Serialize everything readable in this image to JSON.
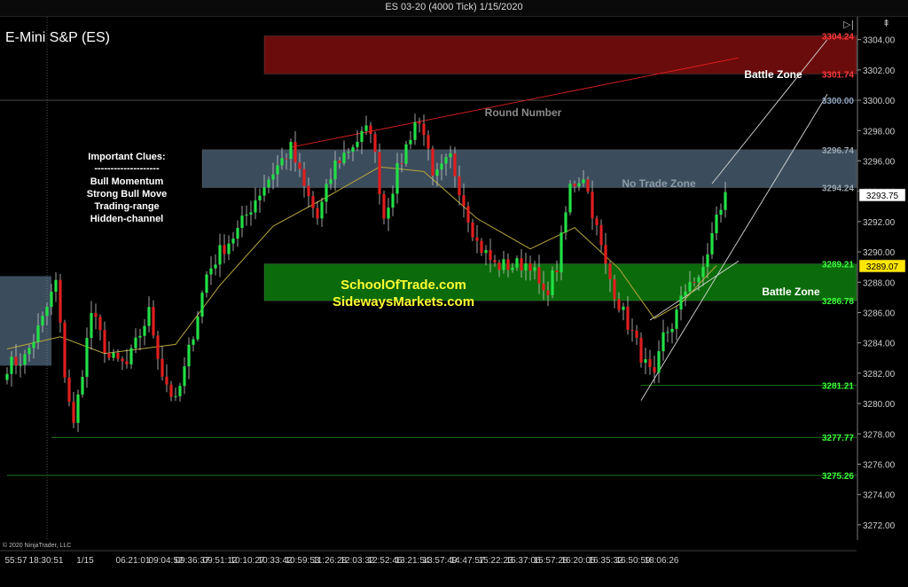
{
  "window": {
    "title": "ES 03-20 (4000 Tick)  1/15/2020",
    "instrument": "E-Mini S&P (ES)",
    "copyright": "© 2020 NinjaTrader, LLC"
  },
  "clues": {
    "heading": "Important Clues:",
    "rule": "--------------------",
    "items": [
      "Bull Momentum",
      "Strong Bull Move",
      "Trading-range",
      "Hidden-channel"
    ]
  },
  "zones": [
    {
      "name": "battle-zone-top",
      "label": "Battle Zone",
      "low": 3301.74,
      "high": 3304.24,
      "color": "#6b0c0c",
      "label_color": "#ffffff"
    },
    {
      "name": "no-trade-zone",
      "label": "No Trade Zone",
      "low": 3294.24,
      "high": 3296.74,
      "color": "#3b4d5c",
      "label_color": "#8d9ba6"
    },
    {
      "name": "battle-zone-green",
      "label": "Battle Zone",
      "low": 3286.78,
      "high": 3289.21,
      "color": "#0b6b0b",
      "label_color": "#ffffff"
    }
  ],
  "watermark": [
    "SchoolOfTrade.com",
    "SidewaysMarkets.com"
  ],
  "round_number": {
    "label": "Round Number",
    "value": 3300.0
  },
  "level_labels": [
    {
      "text": "3304.24",
      "value": 3304.24,
      "color": "#ff3b3b"
    },
    {
      "text": "3301.74",
      "value": 3301.74,
      "color": "#ff3b3b"
    },
    {
      "text": "3300.00",
      "value": 3300.0,
      "color": "#8fa3c0"
    },
    {
      "text": "3296.74",
      "value": 3296.74,
      "color": "#9aa7b3"
    },
    {
      "text": "3294.24",
      "value": 3294.24,
      "color": "#9aa7b3"
    },
    {
      "text": "3289.21",
      "value": 3289.21,
      "color": "#3cff3c"
    },
    {
      "text": "3286.78",
      "value": 3286.78,
      "color": "#3cff3c"
    },
    {
      "text": "3281.21",
      "value": 3281.21,
      "color": "#3cff3c"
    },
    {
      "text": "3277.77",
      "value": 3277.77,
      "color": "#3cff3c"
    },
    {
      "text": "3275.26",
      "value": 3275.26,
      "color": "#3cff3c"
    }
  ],
  "price_badges": [
    {
      "text": "3293.75",
      "value": 3293.75,
      "bg": "#ffffff",
      "fg": "#000000"
    },
    {
      "text": "3289.07",
      "value": 3289.07,
      "bg": "#ffe600",
      "fg": "#000000"
    }
  ],
  "chart_data": {
    "type": "candlestick",
    "y_axis": {
      "min": 3271.0,
      "max": 3305.5,
      "ticks": [
        3272,
        3274,
        3276,
        3278,
        3280,
        3282,
        3284,
        3286,
        3288,
        3290,
        3292,
        3294,
        3296,
        3298,
        3300,
        3302,
        3304
      ],
      "tick_labels": [
        "3272.00",
        "3274.00",
        "3276.00",
        "3278.00",
        "3280.00",
        "3282.00",
        "3284.00",
        "3286.00",
        "3288.00",
        "3290.00",
        "3292.00",
        "3294.00",
        "3296.00",
        "3298.00",
        "3300.00",
        "3302.00",
        "3304.00"
      ]
    },
    "x_axis": {
      "labels": [
        "55:57",
        "18:30:51",
        "1/15",
        "06:21:01",
        "09:04:52",
        "09:36:37",
        "09:51:12",
        "10:10:27",
        "10:33:42",
        "10:59:53",
        "11:26:28",
        "12:03:32",
        "12:52:46",
        "13:21:54",
        "13:57:49",
        "14:47:57",
        "15:22:23",
        "15:37:06",
        "15:57:28",
        "16:20:05",
        "16:35:32",
        "16:50:59",
        "18:06:26"
      ]
    },
    "bar_count": 139,
    "keypoints": [
      [
        0,
        3282.5
      ],
      [
        4,
        3283
      ],
      [
        8,
        3285.5
      ],
      [
        11,
        3288
      ],
      [
        13,
        3282
      ],
      [
        15,
        3278.5
      ],
      [
        19,
        3286
      ],
      [
        23,
        3283
      ],
      [
        27,
        3282.5
      ],
      [
        32,
        3286
      ],
      [
        35,
        3282
      ],
      [
        38,
        3280
      ],
      [
        40,
        3282.2
      ],
      [
        45,
        3288.5
      ],
      [
        48,
        3290
      ],
      [
        52,
        3291.4
      ],
      [
        56,
        3293.5
      ],
      [
        60,
        3295.3
      ],
      [
        64,
        3296.8
      ],
      [
        67,
        3294.2
      ],
      [
        70,
        3292.2
      ],
      [
        74,
        3295.8
      ],
      [
        78,
        3297.1
      ],
      [
        82,
        3298.2
      ],
      [
        85,
        3292.3
      ],
      [
        88,
        3295.3
      ],
      [
        92,
        3298.6
      ],
      [
        94,
        3298.1
      ],
      [
        96,
        3294.6
      ],
      [
        100,
        3296.2
      ],
      [
        103,
        3293.3
      ],
      [
        106,
        3290.6
      ],
      [
        110,
        3289.1
      ],
      [
        114,
        3289.1
      ],
      [
        118,
        3289.3
      ],
      [
        121,
        3287.0
      ],
      [
        124,
        3289.0
      ],
      [
        127,
        3294.3
      ],
      [
        130,
        3295.1
      ],
      [
        132,
        3292.7
      ],
      [
        135,
        3289.0
      ],
      [
        138,
        3286.6
      ],
      [
        141,
        3284.6
      ],
      [
        144,
        3282.5
      ],
      [
        146,
        3281.5
      ],
      [
        148,
        3284.4
      ],
      [
        150,
        3285.2
      ],
      [
        152,
        3286.7
      ],
      [
        154,
        3288.3
      ],
      [
        156,
        3287.9
      ],
      [
        158,
        3290.0
      ],
      [
        160,
        3292.2
      ],
      [
        162,
        3293.7
      ]
    ],
    "moving_average": {
      "values": [
        [
          0,
          3283.6
        ],
        [
          12,
          3284.4
        ],
        [
          22,
          3283.3
        ],
        [
          38,
          3283.9
        ],
        [
          48,
          3287.8
        ],
        [
          60,
          3291.7
        ],
        [
          72,
          3293.6
        ],
        [
          84,
          3295.6
        ],
        [
          94,
          3295.3
        ],
        [
          106,
          3292.2
        ],
        [
          118,
          3290.2
        ],
        [
          128,
          3291.6
        ],
        [
          138,
          3288.9
        ],
        [
          146,
          3285.6
        ],
        [
          152,
          3286.6
        ],
        [
          160,
          3289.1
        ]
      ]
    },
    "trendlines": [
      {
        "name": "red-resistance-line",
        "from": [
          64,
          3296.9
        ],
        "to": [
          165,
          3302.8
        ]
      },
      {
        "name": "channel-upper-line",
        "from": [
          159,
          3294.5
        ],
        "to": [
          185,
          3304.0
        ]
      },
      {
        "name": "channel-lower-line",
        "from": [
          143,
          3280.2
        ],
        "to": [
          185,
          3300.4
        ]
      },
      {
        "name": "channel-inner-line",
        "from": [
          145,
          3285.5
        ],
        "to": [
          165,
          3289.4
        ]
      }
    ],
    "support_lines": [
      {
        "name": "support-3281",
        "from": 143,
        "value": 3281.21
      },
      {
        "name": "support-3277",
        "from": 10,
        "value": 3277.77
      },
      {
        "name": "support-3275",
        "from": 0,
        "value": 3275.26
      }
    ],
    "gray_box": {
      "from": 0,
      "to": 10,
      "low": 3282.5,
      "high": 3288.4,
      "color": "#3b4d5c"
    },
    "session_line": 9,
    "zone_start_bars": {
      "battle-zone-top": 58,
      "no-trade-zone": 44,
      "battle-zone-green": 58
    }
  }
}
